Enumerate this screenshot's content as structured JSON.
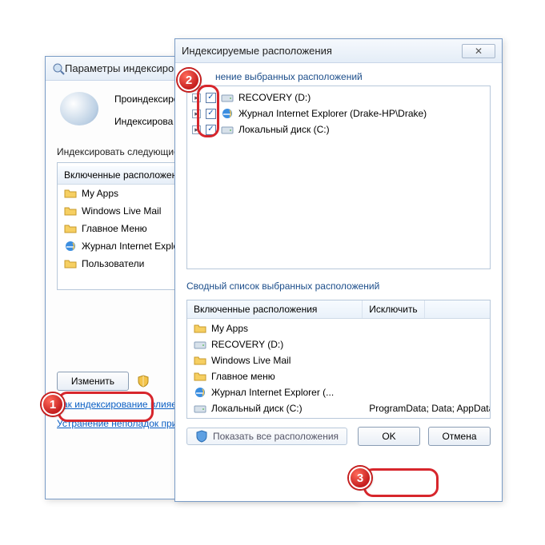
{
  "backWindow": {
    "title": "Параметры индексирова",
    "line1": "Проиндексиров",
    "line2": "Индексирова",
    "section": "Индексировать следующие",
    "listHeader": "Включенные расположени",
    "items": [
      {
        "icon": "folder",
        "label": "My Apps"
      },
      {
        "icon": "folder",
        "label": "Windows Live Mail"
      },
      {
        "icon": "folder",
        "label": "Главное Меню"
      },
      {
        "icon": "ie",
        "label": "Журнал Internet Explore"
      },
      {
        "icon": "folder",
        "label": "Пользователи"
      }
    ],
    "modifyBtn": "Изменить",
    "link1": "Как индексирование влияе",
    "link2": "Устранение неполадок при и"
  },
  "frontWindow": {
    "title": "Индексируемые расположения",
    "group1": "нение выбранных расположений",
    "tree": [
      {
        "icon": "drive",
        "label": "RECOVERY (D:)",
        "checked": true
      },
      {
        "icon": "ie",
        "label": "Журнал Internet Explorer (Drake-HP\\Drake)",
        "checked": true
      },
      {
        "icon": "drive",
        "label": "Локальный диск (C:)",
        "checked": true
      }
    ],
    "group2": "Сводный список выбранных расположений",
    "colInclude": "Включенные расположения",
    "colExclude": "Исключить",
    "summary": [
      {
        "icon": "folder",
        "label": "My Apps",
        "exclude": ""
      },
      {
        "icon": "drive",
        "label": "RECOVERY (D:)",
        "exclude": ""
      },
      {
        "icon": "folder",
        "label": "Windows Live Mail",
        "exclude": ""
      },
      {
        "icon": "folder",
        "label": "Главное меню",
        "exclude": ""
      },
      {
        "icon": "ie",
        "label": "Журнал Internet Explorer (...",
        "exclude": ""
      },
      {
        "icon": "drive",
        "label": "Локальный диск (C:)",
        "exclude": "ProgramData; Data; AppData;..."
      }
    ],
    "showAll": "Показать все расположения",
    "ok": "OK",
    "cancel": "Отмена"
  },
  "badges": {
    "b1": "1",
    "b2": "2",
    "b3": "3"
  }
}
